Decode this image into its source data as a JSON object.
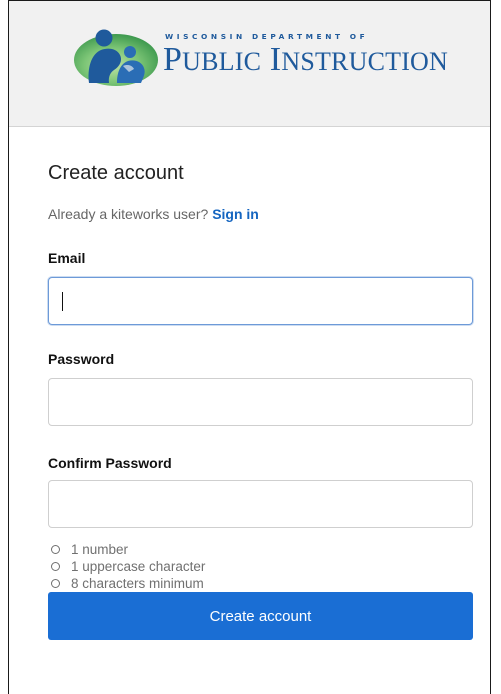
{
  "header": {
    "logo_top_text": "WISCONSIN DEPARTMENT OF",
    "logo_main_text": "PUBLIC INSTRUCTION",
    "logo_main_parts": {
      "p": "P",
      "ublic": "UBLIC",
      "i": " I",
      "nstruction": "NSTRUCTION"
    },
    "brand_color": "#1f5a9c",
    "logo_icon": "family-icon"
  },
  "form": {
    "title": "Create account",
    "signin_prompt": "Already a kiteworks user?",
    "signin_link": "Sign in",
    "email_label": "Email",
    "email_value": "",
    "password_label": "Password",
    "password_value": "",
    "confirm_password_label": "Confirm Password",
    "confirm_password_value": "",
    "requirements": [
      "1 number",
      "1 uppercase character",
      "8 characters minimum"
    ],
    "submit_label": "Create account",
    "accent_color": "#1a6ed4",
    "link_color": "#1565c0"
  }
}
